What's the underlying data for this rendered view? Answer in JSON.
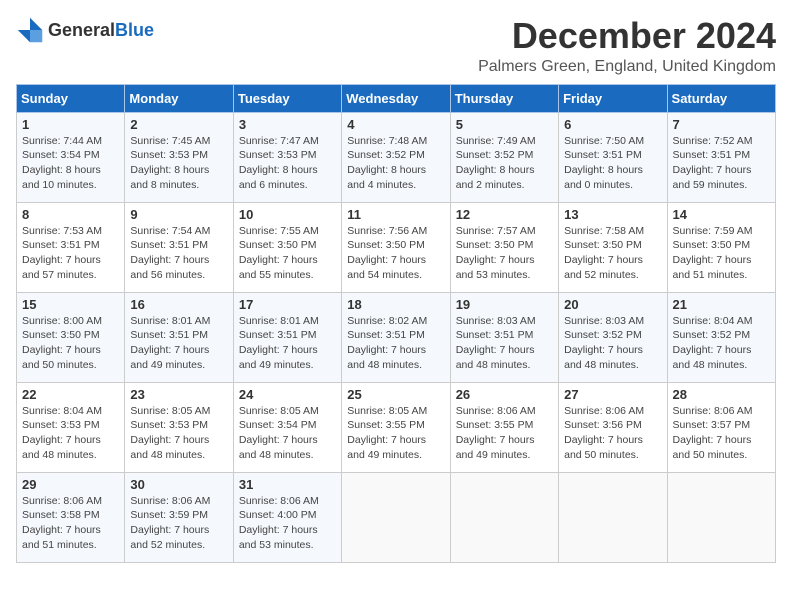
{
  "header": {
    "logo_general": "General",
    "logo_blue": "Blue",
    "month_title": "December 2024",
    "location": "Palmers Green, England, United Kingdom"
  },
  "weekdays": [
    "Sunday",
    "Monday",
    "Tuesday",
    "Wednesday",
    "Thursday",
    "Friday",
    "Saturday"
  ],
  "weeks": [
    [
      {
        "day": "1",
        "sunrise": "Sunrise: 7:44 AM",
        "sunset": "Sunset: 3:54 PM",
        "daylight": "Daylight: 8 hours and 10 minutes."
      },
      {
        "day": "2",
        "sunrise": "Sunrise: 7:45 AM",
        "sunset": "Sunset: 3:53 PM",
        "daylight": "Daylight: 8 hours and 8 minutes."
      },
      {
        "day": "3",
        "sunrise": "Sunrise: 7:47 AM",
        "sunset": "Sunset: 3:53 PM",
        "daylight": "Daylight: 8 hours and 6 minutes."
      },
      {
        "day": "4",
        "sunrise": "Sunrise: 7:48 AM",
        "sunset": "Sunset: 3:52 PM",
        "daylight": "Daylight: 8 hours and 4 minutes."
      },
      {
        "day": "5",
        "sunrise": "Sunrise: 7:49 AM",
        "sunset": "Sunset: 3:52 PM",
        "daylight": "Daylight: 8 hours and 2 minutes."
      },
      {
        "day": "6",
        "sunrise": "Sunrise: 7:50 AM",
        "sunset": "Sunset: 3:51 PM",
        "daylight": "Daylight: 8 hours and 0 minutes."
      },
      {
        "day": "7",
        "sunrise": "Sunrise: 7:52 AM",
        "sunset": "Sunset: 3:51 PM",
        "daylight": "Daylight: 7 hours and 59 minutes."
      }
    ],
    [
      {
        "day": "8",
        "sunrise": "Sunrise: 7:53 AM",
        "sunset": "Sunset: 3:51 PM",
        "daylight": "Daylight: 7 hours and 57 minutes."
      },
      {
        "day": "9",
        "sunrise": "Sunrise: 7:54 AM",
        "sunset": "Sunset: 3:51 PM",
        "daylight": "Daylight: 7 hours and 56 minutes."
      },
      {
        "day": "10",
        "sunrise": "Sunrise: 7:55 AM",
        "sunset": "Sunset: 3:50 PM",
        "daylight": "Daylight: 7 hours and 55 minutes."
      },
      {
        "day": "11",
        "sunrise": "Sunrise: 7:56 AM",
        "sunset": "Sunset: 3:50 PM",
        "daylight": "Daylight: 7 hours and 54 minutes."
      },
      {
        "day": "12",
        "sunrise": "Sunrise: 7:57 AM",
        "sunset": "Sunset: 3:50 PM",
        "daylight": "Daylight: 7 hours and 53 minutes."
      },
      {
        "day": "13",
        "sunrise": "Sunrise: 7:58 AM",
        "sunset": "Sunset: 3:50 PM",
        "daylight": "Daylight: 7 hours and 52 minutes."
      },
      {
        "day": "14",
        "sunrise": "Sunrise: 7:59 AM",
        "sunset": "Sunset: 3:50 PM",
        "daylight": "Daylight: 7 hours and 51 minutes."
      }
    ],
    [
      {
        "day": "15",
        "sunrise": "Sunrise: 8:00 AM",
        "sunset": "Sunset: 3:50 PM",
        "daylight": "Daylight: 7 hours and 50 minutes."
      },
      {
        "day": "16",
        "sunrise": "Sunrise: 8:01 AM",
        "sunset": "Sunset: 3:51 PM",
        "daylight": "Daylight: 7 hours and 49 minutes."
      },
      {
        "day": "17",
        "sunrise": "Sunrise: 8:01 AM",
        "sunset": "Sunset: 3:51 PM",
        "daylight": "Daylight: 7 hours and 49 minutes."
      },
      {
        "day": "18",
        "sunrise": "Sunrise: 8:02 AM",
        "sunset": "Sunset: 3:51 PM",
        "daylight": "Daylight: 7 hours and 48 minutes."
      },
      {
        "day": "19",
        "sunrise": "Sunrise: 8:03 AM",
        "sunset": "Sunset: 3:51 PM",
        "daylight": "Daylight: 7 hours and 48 minutes."
      },
      {
        "day": "20",
        "sunrise": "Sunrise: 8:03 AM",
        "sunset": "Sunset: 3:52 PM",
        "daylight": "Daylight: 7 hours and 48 minutes."
      },
      {
        "day": "21",
        "sunrise": "Sunrise: 8:04 AM",
        "sunset": "Sunset: 3:52 PM",
        "daylight": "Daylight: 7 hours and 48 minutes."
      }
    ],
    [
      {
        "day": "22",
        "sunrise": "Sunrise: 8:04 AM",
        "sunset": "Sunset: 3:53 PM",
        "daylight": "Daylight: 7 hours and 48 minutes."
      },
      {
        "day": "23",
        "sunrise": "Sunrise: 8:05 AM",
        "sunset": "Sunset: 3:53 PM",
        "daylight": "Daylight: 7 hours and 48 minutes."
      },
      {
        "day": "24",
        "sunrise": "Sunrise: 8:05 AM",
        "sunset": "Sunset: 3:54 PM",
        "daylight": "Daylight: 7 hours and 48 minutes."
      },
      {
        "day": "25",
        "sunrise": "Sunrise: 8:05 AM",
        "sunset": "Sunset: 3:55 PM",
        "daylight": "Daylight: 7 hours and 49 minutes."
      },
      {
        "day": "26",
        "sunrise": "Sunrise: 8:06 AM",
        "sunset": "Sunset: 3:55 PM",
        "daylight": "Daylight: 7 hours and 49 minutes."
      },
      {
        "day": "27",
        "sunrise": "Sunrise: 8:06 AM",
        "sunset": "Sunset: 3:56 PM",
        "daylight": "Daylight: 7 hours and 50 minutes."
      },
      {
        "day": "28",
        "sunrise": "Sunrise: 8:06 AM",
        "sunset": "Sunset: 3:57 PM",
        "daylight": "Daylight: 7 hours and 50 minutes."
      }
    ],
    [
      {
        "day": "29",
        "sunrise": "Sunrise: 8:06 AM",
        "sunset": "Sunset: 3:58 PM",
        "daylight": "Daylight: 7 hours and 51 minutes."
      },
      {
        "day": "30",
        "sunrise": "Sunrise: 8:06 AM",
        "sunset": "Sunset: 3:59 PM",
        "daylight": "Daylight: 7 hours and 52 minutes."
      },
      {
        "day": "31",
        "sunrise": "Sunrise: 8:06 AM",
        "sunset": "Sunset: 4:00 PM",
        "daylight": "Daylight: 7 hours and 53 minutes."
      },
      null,
      null,
      null,
      null
    ]
  ]
}
